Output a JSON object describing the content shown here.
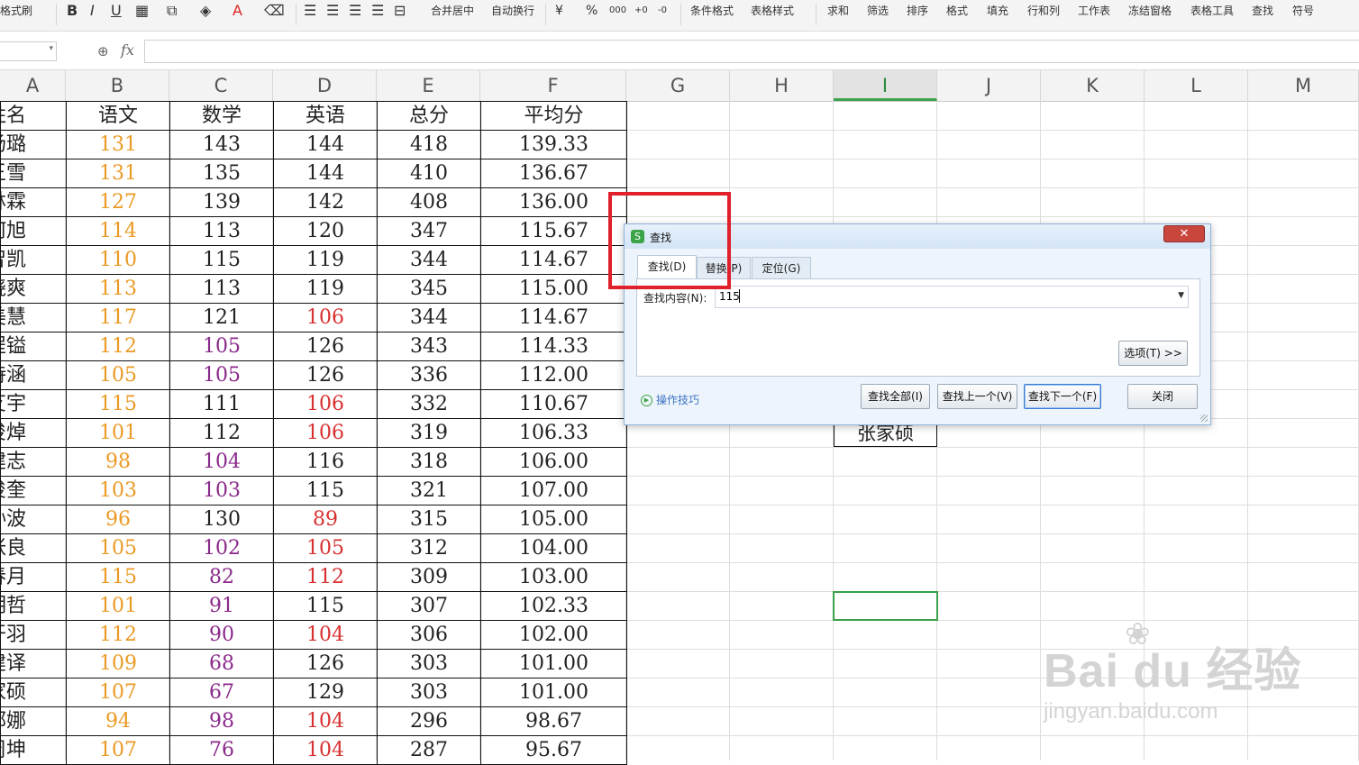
{
  "toolbar": {
    "format_painter": "格式刷",
    "bold": "B",
    "italic": "I",
    "underline": "U",
    "font_color_letter": "A",
    "merge_center": "合并居中",
    "auto_wrap": "自动换行",
    "currency": "¥",
    "percent": "%",
    "thousands": "000",
    "dec_inc": "+0",
    "dec_dec": "-0",
    "conditional_format": "条件格式",
    "table_style": "表格样式",
    "sum": "求和",
    "filter": "筛选",
    "sort": "排序",
    "format": "格式",
    "fill": "填充",
    "row_col": "行和列",
    "worksheet": "工作表",
    "freeze": "冻结窗格",
    "table_tools": "表格工具",
    "find": "查找",
    "symbol": "符号"
  },
  "formula_bar": {
    "fx": "fx",
    "name_value": "",
    "formula_value": ""
  },
  "columns": [
    "A",
    "B",
    "C",
    "D",
    "E",
    "F",
    "G",
    "H",
    "I",
    "J",
    "K",
    "L",
    "M"
  ],
  "selected_column": "I",
  "table": {
    "headers": [
      "姓名",
      "语文",
      "数学",
      "英语",
      "总分",
      "平均分"
    ],
    "rows": [
      [
        "汤璐",
        "131",
        "143",
        "144",
        "418",
        "139.33"
      ],
      [
        "王雪",
        "131",
        "135",
        "144",
        "410",
        "136.67"
      ],
      [
        "林霖",
        "127",
        "139",
        "142",
        "408",
        "136.00"
      ],
      [
        "何旭",
        "114",
        "113",
        "120",
        "347",
        "115.67"
      ],
      [
        "智凯",
        "110",
        "115",
        "119",
        "344",
        "114.67"
      ],
      [
        "晓爽",
        "113",
        "113",
        "119",
        "345",
        "115.00"
      ],
      [
        "美慧",
        "117",
        "121",
        "106",
        "344",
        "114.67"
      ],
      [
        "埕镒",
        "112",
        "105",
        "126",
        "343",
        "114.33"
      ],
      [
        "诗涵",
        "105",
        "105",
        "126",
        "336",
        "112.00"
      ],
      [
        "艾宇",
        "115",
        "111",
        "106",
        "332",
        "110.67"
      ],
      [
        "俊焯",
        "101",
        "112",
        "106",
        "319",
        "106.33"
      ],
      [
        "建志",
        "98",
        "104",
        "116",
        "318",
        "106.00"
      ],
      [
        "俊奎",
        "103",
        "103",
        "115",
        "321",
        "107.00"
      ],
      [
        "孙波",
        "96",
        "130",
        "89",
        "315",
        "105.00"
      ],
      [
        "张良",
        "105",
        "102",
        "105",
        "312",
        "104.00"
      ],
      [
        "春月",
        "115",
        "82",
        "112",
        "309",
        "103.00"
      ],
      [
        "明哲",
        "101",
        "91",
        "115",
        "307",
        "102.33"
      ],
      [
        "开羽",
        "112",
        "90",
        "104",
        "306",
        "102.00"
      ],
      [
        "建译",
        "109",
        "68",
        "126",
        "303",
        "101.00"
      ],
      [
        "家硕",
        "107",
        "67",
        "129",
        "303",
        "101.00"
      ],
      [
        "郭娜",
        "94",
        "98",
        "104",
        "296",
        "98.67"
      ],
      [
        "周坤",
        "107",
        "76",
        "104",
        "287",
        "95.67"
      ]
    ],
    "colors": {
      "chinese": "#ea9a25",
      "math_low": "#8a2a8a",
      "english_low": "#d83030"
    }
  },
  "result_cell": "张家硕",
  "dialog": {
    "title": "查找",
    "close": "✕",
    "tabs": [
      "查找(D)",
      "替换(P)",
      "定位(G)"
    ],
    "active_tab": 0,
    "find_label": "查找内容(N):",
    "find_value": "115",
    "options_button": "选项(T) >>",
    "tips": "操作技巧",
    "buttons": {
      "find_all": "查找全部(I)",
      "find_prev": "查找上一个(V)",
      "find_next": "查找下一个(F)",
      "close": "关闭"
    }
  },
  "watermark": {
    "logo": "Bai du 经验",
    "url": "jingyan.baidu.com"
  }
}
